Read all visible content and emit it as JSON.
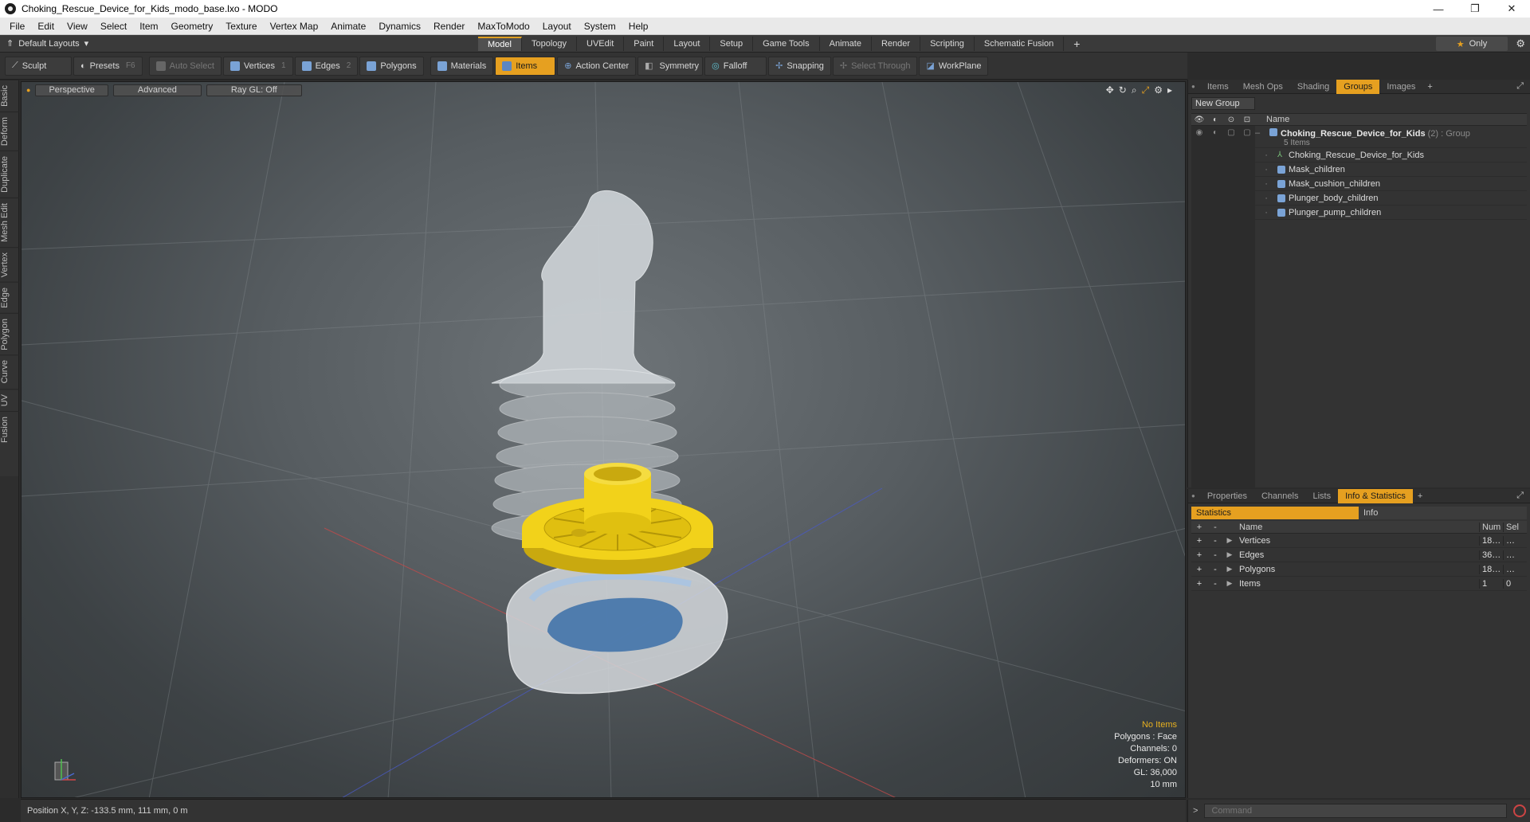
{
  "window": {
    "title": "Choking_Rescue_Device_for_Kids_modo_base.lxo - MODO"
  },
  "menu": [
    "File",
    "Edit",
    "View",
    "Select",
    "Item",
    "Geometry",
    "Texture",
    "Vertex Map",
    "Animate",
    "Dynamics",
    "Render",
    "MaxToModo",
    "Layout",
    "System",
    "Help"
  ],
  "layout": {
    "preset": "Default Layouts",
    "tabs": [
      "Model",
      "Topology",
      "UVEdit",
      "Paint",
      "Layout",
      "Setup",
      "Game Tools",
      "Animate",
      "Render",
      "Scripting",
      "Schematic Fusion"
    ],
    "active_tab": "Model",
    "only_label": "Only"
  },
  "toolbar": {
    "sculpt": "Sculpt",
    "presets": "Presets",
    "presets_key": "F6",
    "auto_select": "Auto Select",
    "vertices": "Vertices",
    "vertices_key": "1",
    "edges": "Edges",
    "edges_key": "2",
    "polygons": "Polygons",
    "materials": "Materials",
    "items": "Items",
    "action_center": "Action Center",
    "symmetry": "Symmetry",
    "falloff": "Falloff",
    "snapping": "Snapping",
    "select_through": "Select Through",
    "workplane": "WorkPlane"
  },
  "left_tabs": [
    "Basic",
    "Deform",
    "Duplicate",
    "Mesh Edit",
    "Vertex",
    "Edge",
    "Polygon",
    "Curve",
    "UV",
    "Fusion"
  ],
  "viewport": {
    "view_mode": "Perspective",
    "shading": "Advanced",
    "raygl": "Ray GL: Off",
    "stats": {
      "selection": "No Items",
      "polygons": "Polygons : Face",
      "channels": "Channels: 0",
      "deformers": "Deformers: ON",
      "gl": "GL: 36,000",
      "unit": "10 mm"
    }
  },
  "status": {
    "position": "Position X, Y, Z:  -133.5 mm, 111 mm, 0 m"
  },
  "items_panel": {
    "tabs": [
      "Items",
      "Mesh Ops",
      "Shading",
      "Groups",
      "Images"
    ],
    "active_tab": "Groups",
    "new_group": "New Group",
    "name_header": "Name",
    "group": {
      "name": "Choking_Rescue_Device_for_Kids",
      "type": " (2) : Group",
      "sub": "5 Items"
    },
    "children": [
      "Choking_Rescue_Device_for_Kids",
      "Mask_children",
      "Mask_cushion_children",
      "Plunger_body_children",
      "Plunger_pump_children"
    ]
  },
  "props_panel": {
    "tabs": [
      "Properties",
      "Channels",
      "Lists",
      "Info & Statistics"
    ],
    "active_tab": "Info & Statistics",
    "stat_tabs": [
      "Statistics",
      "Info"
    ],
    "headers": {
      "name": "Name",
      "num": "Num",
      "sel": "Sel"
    },
    "rows": [
      {
        "name": "Vertices",
        "num": "18…",
        "sel": "…"
      },
      {
        "name": "Edges",
        "num": "36…",
        "sel": "…"
      },
      {
        "name": "Polygons",
        "num": "18…",
        "sel": "…"
      },
      {
        "name": "Items",
        "num": "1",
        "sel": "0"
      }
    ]
  },
  "command": {
    "placeholder": "Command"
  },
  "colors": {
    "accent": "#e6a020",
    "plunger_yellow": "#f2d21a",
    "mesh_blue": "#7aa3d6"
  }
}
